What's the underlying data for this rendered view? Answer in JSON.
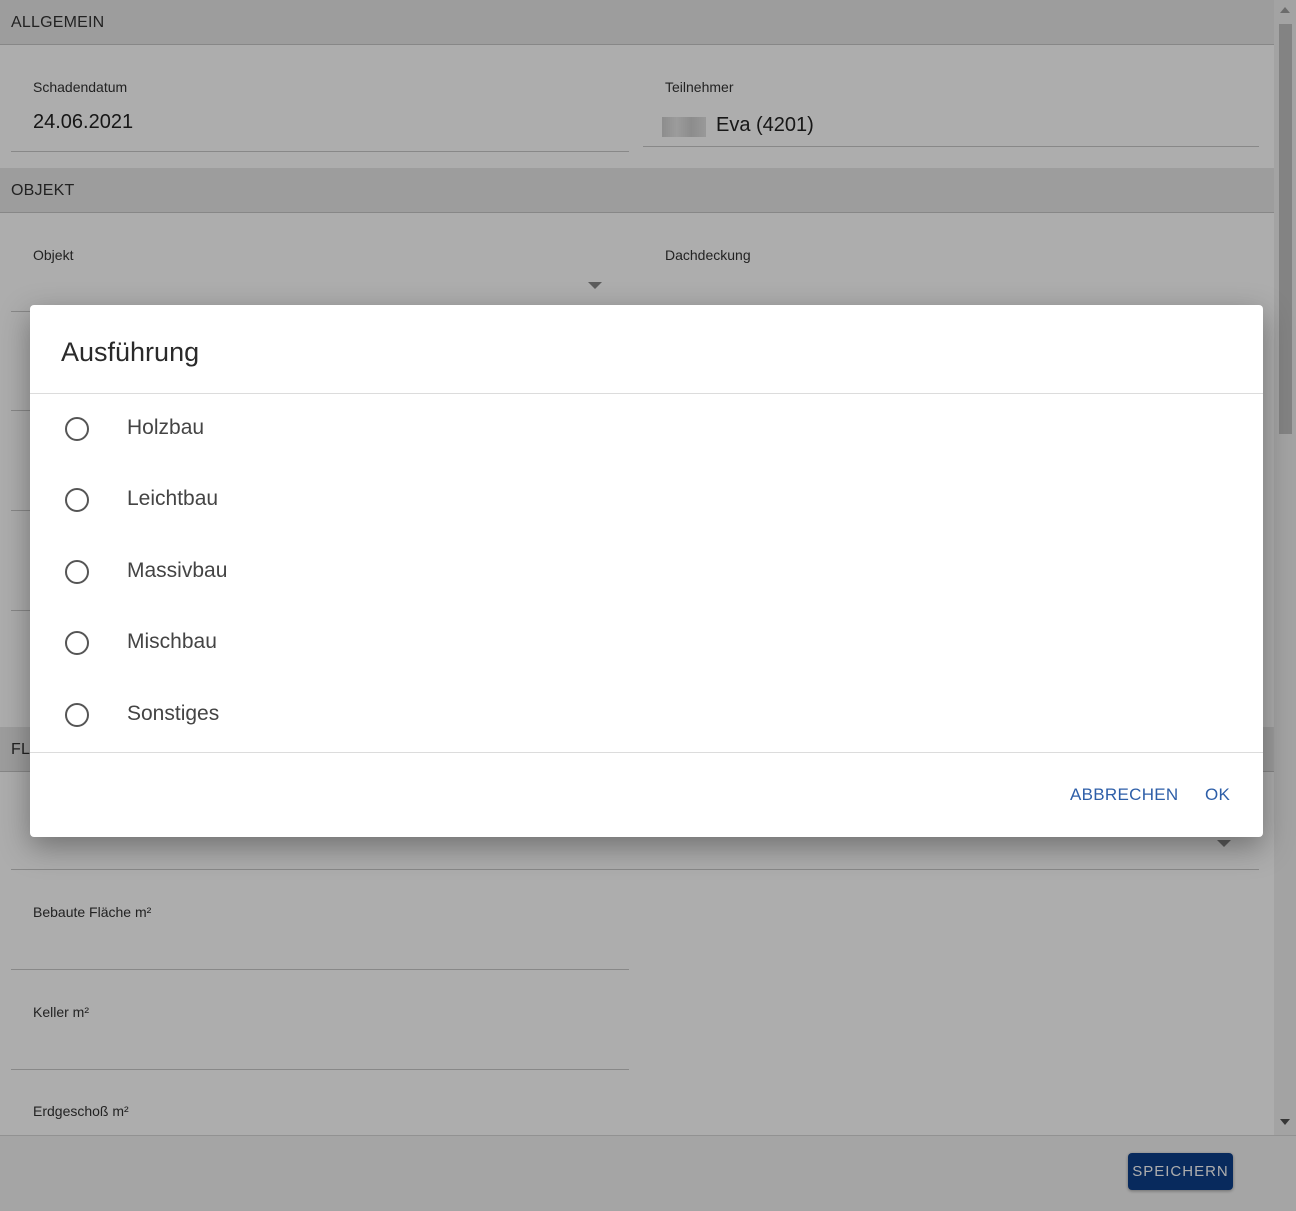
{
  "sections": {
    "allgemein": "ALLGEMEIN",
    "objekt": "OBJEKT",
    "flaechen_partial": "FL"
  },
  "fields": {
    "schadendatum": {
      "label": "Schadendatum",
      "value": "24.06.2021"
    },
    "teilnehmer": {
      "label": "Teilnehmer",
      "value": "Eva (4201)"
    },
    "objekt": {
      "label": "Objekt",
      "value": ""
    },
    "dachdeckung": {
      "label": "Dachdeckung",
      "value": ""
    },
    "bebaute_flaeche": {
      "label": "Bebaute Fläche m²",
      "value": ""
    },
    "keller": {
      "label": "Keller m²",
      "value": ""
    },
    "erdgeschoss": {
      "label": "Erdgeschoß m²",
      "value": ""
    }
  },
  "footer": {
    "save_label": "SPEICHERN"
  },
  "dialog": {
    "title": "Ausführung",
    "options": [
      {
        "label": "Holzbau",
        "selected": false
      },
      {
        "label": "Leichtbau",
        "selected": false
      },
      {
        "label": "Massivbau",
        "selected": false
      },
      {
        "label": "Mischbau",
        "selected": false
      },
      {
        "label": "Sonstiges",
        "selected": false
      }
    ],
    "cancel_label": "ABBRECHEN",
    "ok_label": "OK"
  },
  "colors": {
    "primary": "#0d3f8a",
    "dialog_button": "#2d5ea8",
    "section_header": "#e8e8e8"
  }
}
